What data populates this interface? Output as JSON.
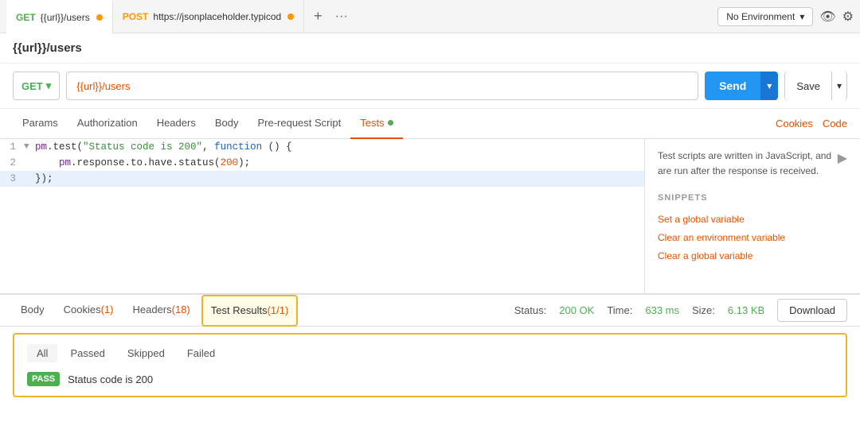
{
  "tabs": [
    {
      "method": "GET",
      "method_class": "get",
      "url": "{{url}}/users",
      "active": true,
      "dot_color": "orange"
    },
    {
      "method": "POST",
      "method_class": "post",
      "url": "https://jsonplaceholder.typicod",
      "active": false,
      "dot_color": "orange"
    }
  ],
  "tab_actions": {
    "plus": "+",
    "dots": "···"
  },
  "environment": {
    "label": "No Environment",
    "chevron": "▾"
  },
  "request_title": "{{url}}/users",
  "url_bar": {
    "method": "GET",
    "method_chevron": "▾",
    "url_value": "{{url}}/users",
    "send_label": "Send",
    "send_chevron": "▾",
    "save_label": "Save",
    "save_chevron": "▾"
  },
  "request_tabs": [
    {
      "label": "Params",
      "active": false,
      "badge": null
    },
    {
      "label": "Authorization",
      "active": false,
      "badge": null
    },
    {
      "label": "Headers",
      "active": false,
      "badge": null
    },
    {
      "label": "Body",
      "active": false,
      "badge": null
    },
    {
      "label": "Pre-request Script",
      "active": false,
      "badge": null
    },
    {
      "label": "Tests",
      "active": true,
      "badge": "dot"
    }
  ],
  "request_tab_right": [
    {
      "label": "Cookies"
    },
    {
      "label": "Code"
    }
  ],
  "code_lines": [
    {
      "num": "1",
      "bullet": "▼",
      "content_html": true,
      "text": "pm.test(\"Status code is 200\", function () {"
    },
    {
      "num": "2",
      "bullet": " ",
      "content_html": false,
      "text": "    pm.response.to.have.status(200);"
    },
    {
      "num": "3",
      "bullet": " ",
      "content_html": false,
      "text": "});"
    }
  ],
  "sidebar": {
    "info_text": "Test scripts are written in JavaScript, and are run after the response is received.",
    "arrow": "▶",
    "snippets_title": "SNIPPETS",
    "snippets": [
      "Set a global variable",
      "Clear an environment variable",
      "Clear a global variable"
    ]
  },
  "response_tabs": [
    {
      "label": "Body",
      "badge": null,
      "active": false
    },
    {
      "label": "Cookies",
      "badge": "(1)",
      "active": false
    },
    {
      "label": "Headers",
      "badge": "(18)",
      "active": false
    },
    {
      "label": "Test Results",
      "badge": "(1/1)",
      "active": true
    }
  ],
  "status_bar": {
    "status_label": "Status:",
    "status_value": "200 OK",
    "time_label": "Time:",
    "time_value": "633 ms",
    "size_label": "Size:",
    "size_value": "6.13 KB",
    "download_label": "Download"
  },
  "test_results": {
    "filter_tabs": [
      {
        "label": "All",
        "active": true
      },
      {
        "label": "Passed",
        "active": false
      },
      {
        "label": "Skipped",
        "active": false
      },
      {
        "label": "Failed",
        "active": false
      }
    ],
    "rows": [
      {
        "status": "PASS",
        "name": "Status code is 200"
      }
    ]
  }
}
